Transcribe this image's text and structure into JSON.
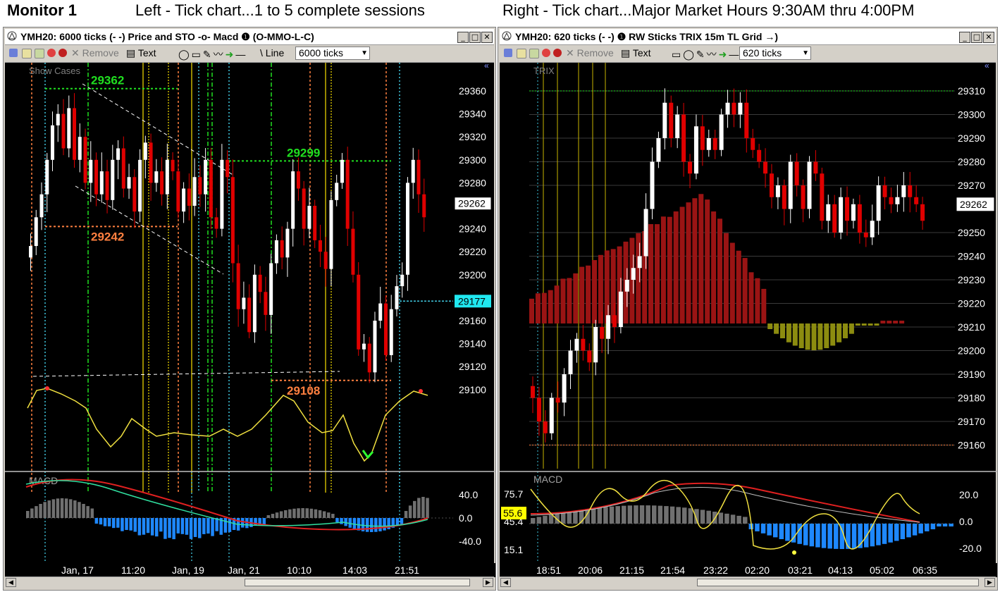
{
  "banner": {
    "monitor": "Monitor 1",
    "left_caption": "Left - Tick chart...1 to 5 complete sessions",
    "right_caption": "Right - Tick chart...Major Market Hours 9:30AM thru 4:00PM"
  },
  "toolbar": {
    "remove": "Remove",
    "text": "Text",
    "line": "Line"
  },
  "left": {
    "title": "YMH20: 6000 ticks (- -) Price and STO -o- Macd ❶ (O-MMO-L-C)",
    "tick_combo": "6000 ticks",
    "show_cases": "Show Cases",
    "price_ticks": [
      "29360",
      "29340",
      "29320",
      "29300",
      "29280",
      "29240",
      "29220",
      "29200",
      "29160",
      "29140",
      "29120",
      "29100"
    ],
    "current_price": "29262",
    "marker_price": "29177",
    "annotations": {
      "high": "29362",
      "mid_high": "29299",
      "low_mark": "29242",
      "low": "29108"
    },
    "macd_label": "MACD",
    "macd_ticks": [
      "40.0",
      "0.0",
      "-40.0"
    ],
    "time_labels": [
      "Jan, 17",
      "11:20",
      "Jan, 19",
      "Jan, 21",
      "10:10",
      "14:03",
      "21:51"
    ]
  },
  "right": {
    "title": "YMH20: 620 ticks (- -)   ❶ RW Sticks TRIX 15m TL Grid →)",
    "tick_combo": "620 ticks",
    "trix_label": "TRIX",
    "price_ticks": [
      "29310",
      "29300",
      "29290",
      "29280",
      "29270",
      "29250",
      "29240",
      "29230",
      "29220",
      "29210",
      "29200",
      "29190",
      "29180",
      "29170",
      "29160"
    ],
    "current_price": "29262",
    "macd_label": "MACD",
    "macd_ticks": [
      "20.0",
      "0.0",
      "-20.0"
    ],
    "sto_ticks": [
      "75.7",
      "45.4",
      "15.1"
    ],
    "sto_value": "55.6",
    "time_labels": [
      "18:51",
      "20:06",
      "21:15",
      "21:54",
      "23:22",
      "02:20",
      "03:21",
      "04:13",
      "05:02",
      "06:35"
    ]
  },
  "colors": {
    "up": "#ffffff",
    "down": "#e00000",
    "green_line": "#20e020",
    "orange_line": "#ff8040",
    "yellow_line": "#c8b400",
    "cyan": "#40c8e0",
    "macd_pos": "#707070",
    "macd_neg": "#1e88ff",
    "trix_pos": "#9a1414",
    "trix_neg": "#8c8c10",
    "sto": "#f0e040"
  }
}
